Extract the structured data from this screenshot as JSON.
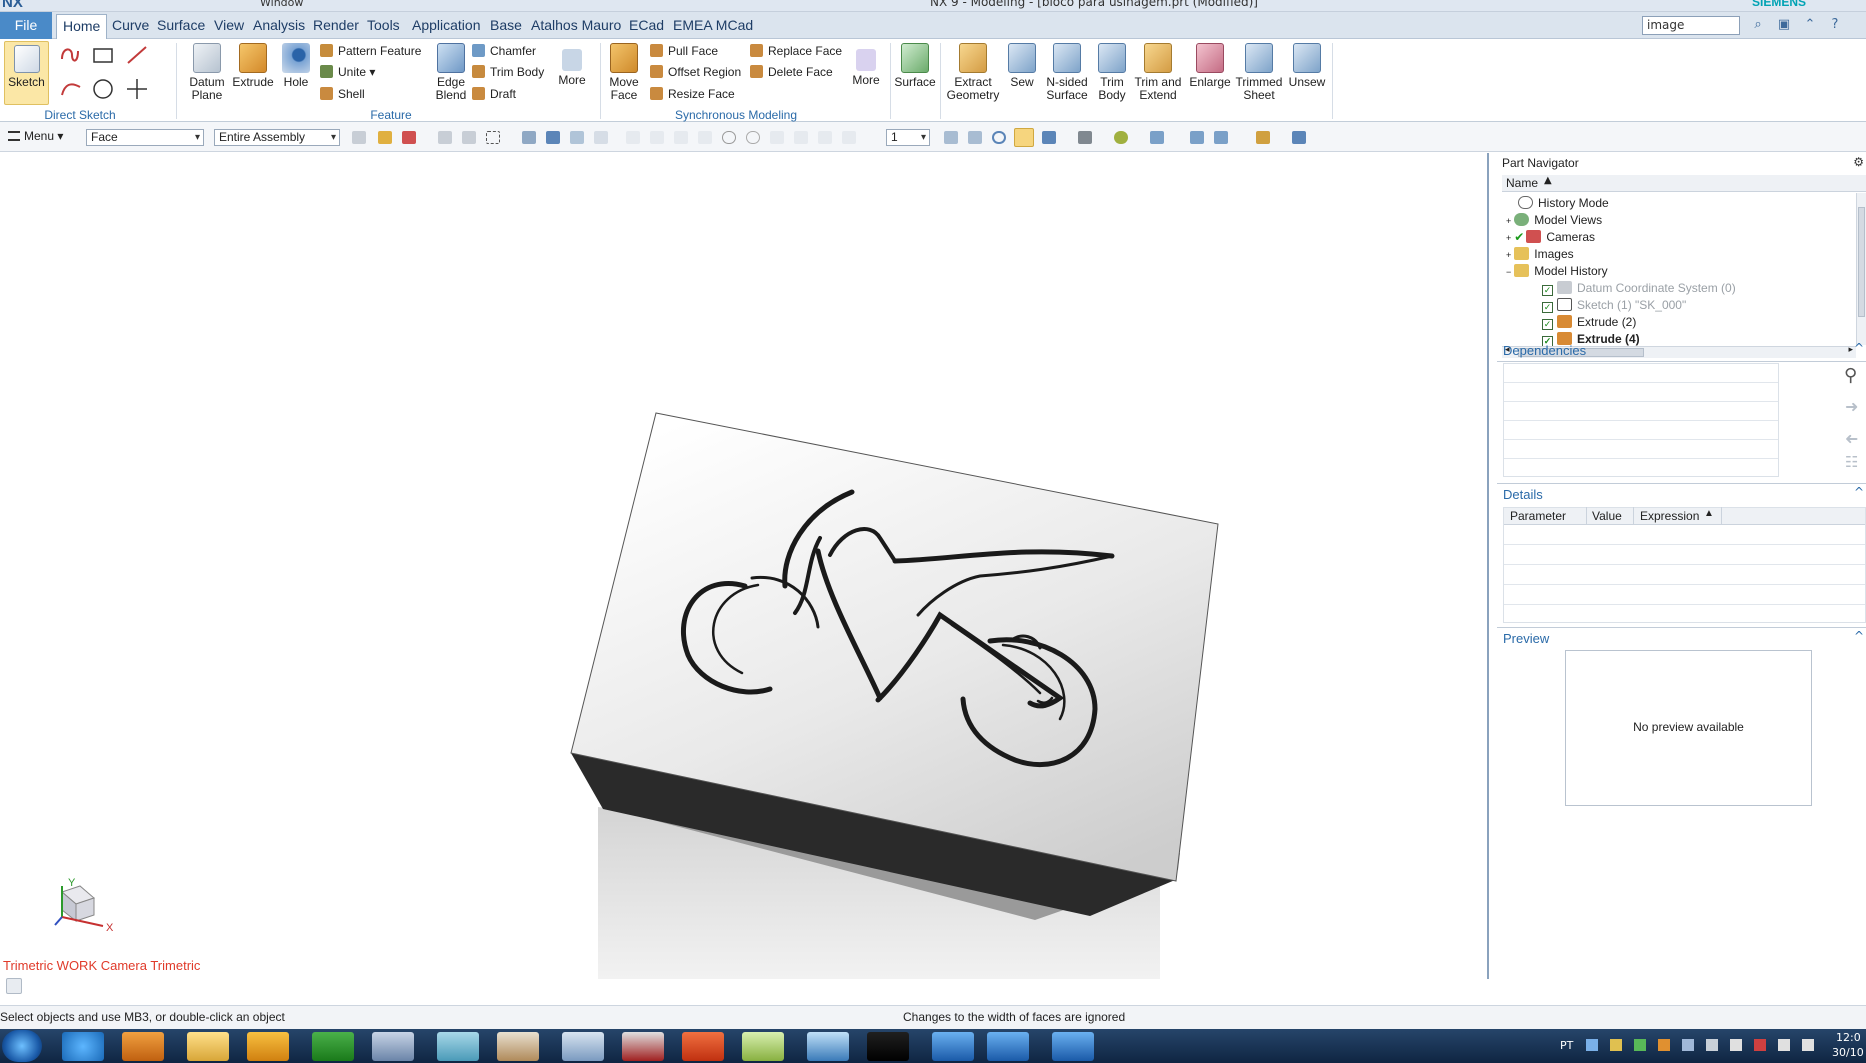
{
  "window": {
    "logo": "NX",
    "title": "NX 9 - Modeling - [bloco para usinagem.prt (Modified)]",
    "brand": "SIEMENS",
    "quick_window": "Window"
  },
  "menubar": {
    "file": "File",
    "tabs": [
      "Home",
      "Curve",
      "Surface",
      "View",
      "Analysis",
      "Render",
      "Tools",
      "Application",
      "Base",
      "Atalhos Mauro",
      "ECad",
      "EMEA MCad"
    ],
    "search_value": "image"
  },
  "ribbon": {
    "sketch": "Sketch",
    "datum_plane": "Datum Plane",
    "extrude": "Extrude",
    "hole": "Hole",
    "pattern_feature": "Pattern Feature",
    "unite": "Unite",
    "shell": "Shell",
    "edge_blend": "Edge Blend",
    "chamfer": "Chamfer",
    "trim_body": "Trim Body",
    "draft": "Draft",
    "more1": "More",
    "move_face": "Move Face",
    "pull_face": "Pull Face",
    "offset_region": "Offset Region",
    "resize_face": "Resize Face",
    "replace_face": "Replace Face",
    "delete_face": "Delete Face",
    "more2": "More",
    "surface": "Surface",
    "extract_geometry": "Extract Geometry",
    "sew": "Sew",
    "n_sided_surface": "N-sided Surface",
    "trim_body2": "Trim Body",
    "trim_and_extend": "Trim and Extend",
    "enlarge": "Enlarge",
    "trimmed_sheet": "Trimmed Sheet",
    "unsew": "Unsew",
    "groups": {
      "direct_sketch": "Direct Sketch",
      "feature": "Feature",
      "synchronous_modeling": "Synchronous Modeling"
    }
  },
  "toolbar2": {
    "menu": "Menu",
    "filter": "Face",
    "scope": "Entire Assembly",
    "layer": "1"
  },
  "viewport": {
    "camera_label": "Trimetric WORK Camera Trimetric",
    "axis_x": "X",
    "axis_y": "Y"
  },
  "navigator": {
    "title": "Part Navigator",
    "column": "Name",
    "rows": [
      {
        "label": "History Mode"
      },
      {
        "label": "Model Views"
      },
      {
        "label": "Cameras"
      },
      {
        "label": "Images"
      },
      {
        "label": "Model History"
      },
      {
        "label": "Datum Coordinate System (0)"
      },
      {
        "label": "Sketch (1) \"SK_000\""
      },
      {
        "label": "Extrude (2)"
      },
      {
        "label": "Extrude (4)"
      }
    ]
  },
  "dependencies": {
    "title": "Dependencies"
  },
  "details": {
    "title": "Details",
    "columns": [
      "Parameter",
      "Value",
      "Expression"
    ]
  },
  "preview": {
    "title": "Preview",
    "message": "No preview available"
  },
  "status": {
    "left": "Select objects and use MB3, or double-click an object",
    "center": "Changes to the width of faces are ignored"
  },
  "taskbar": {
    "lang": "PT",
    "time": "12:0",
    "date": "30/10"
  }
}
